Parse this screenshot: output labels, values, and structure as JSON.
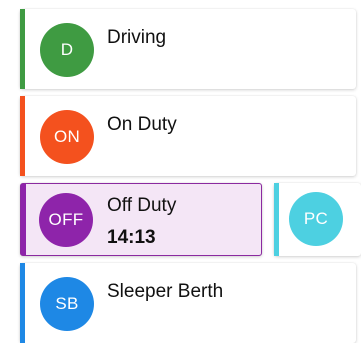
{
  "statuses": [
    {
      "abbr": "D",
      "label": "Driving",
      "color": "#3f9b42"
    },
    {
      "abbr": "ON",
      "label": "On Duty",
      "color": "#f4511e"
    },
    {
      "abbr": "OFF",
      "label": "Off Duty",
      "time": "14:13",
      "color": "#8e24aa",
      "selected": true
    },
    {
      "abbr": "PC",
      "color": "#4dd0e1"
    },
    {
      "abbr": "SB",
      "label": "Sleeper Berth",
      "color": "#1e88e5"
    }
  ]
}
